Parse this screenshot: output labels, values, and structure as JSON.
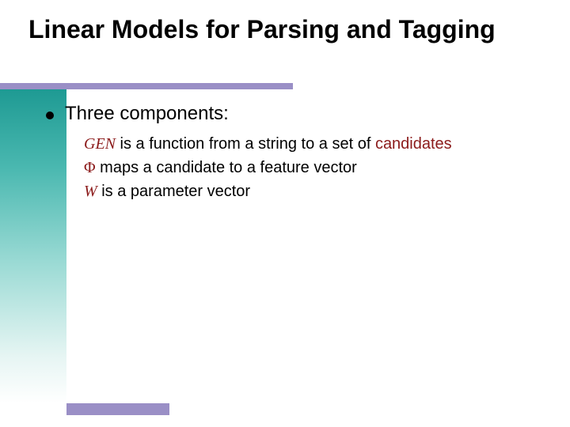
{
  "title": "Linear Models for Parsing and Tagging",
  "bullet": {
    "label": "Three components:"
  },
  "items": [
    {
      "symbol": "GEN",
      "text_before": " is a function from a string to a set of ",
      "highlight": "candidates",
      "text_after": ""
    },
    {
      "symbol": "Φ",
      "text_before": " maps a candidate to a feature vector",
      "highlight": "",
      "text_after": ""
    },
    {
      "symbol": "W",
      "text_before": " is a parameter vector",
      "highlight": "",
      "text_after": ""
    }
  ]
}
